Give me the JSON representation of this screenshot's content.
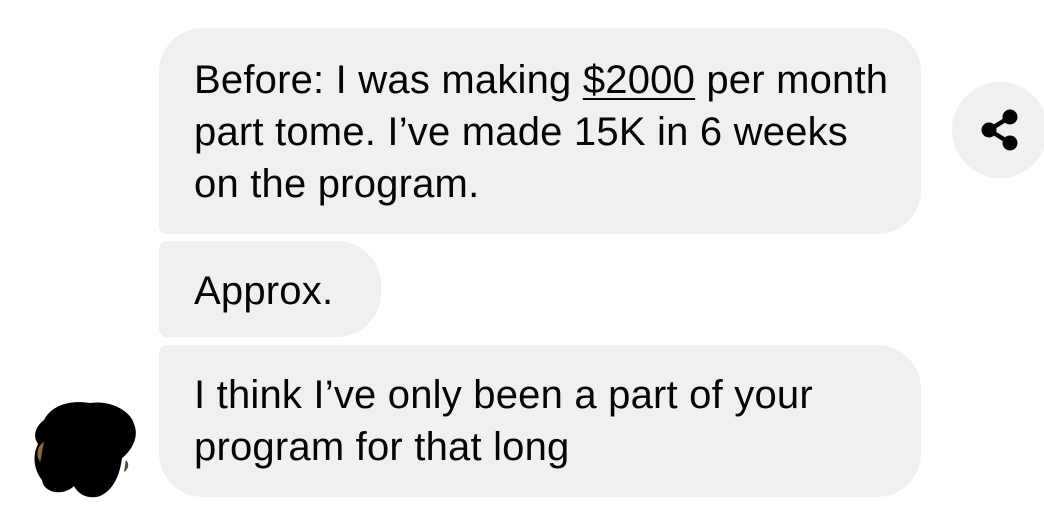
{
  "conversation": {
    "messages": [
      {
        "text_before": "Before: I was making ",
        "amount": "$2000",
        "text_after": " per month part tome. I’ve made 15K in 6 weeks on the program."
      },
      {
        "text": "Approx."
      },
      {
        "text": "I think I’ve only been a part of your program for that long"
      }
    ],
    "share_icon": "share-icon",
    "avatar": "sender-avatar (obscured)"
  },
  "colors": {
    "bubble": "#f0f0f0",
    "text": "#050505",
    "icon": "#050505",
    "background": "#ffffff"
  }
}
